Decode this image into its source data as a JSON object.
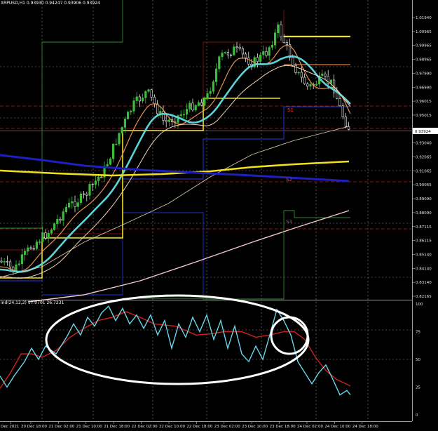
{
  "window": {
    "main_title": "XRPUSD,H1  0.93930 0.94247 0.93906 0.93924",
    "indicator_title": "ind(24,12,2) 17.0701 26.7231",
    "current_price": "0.93924"
  },
  "chart_data": {
    "type": "candlestick",
    "price_axis": {
      "labels": [
        "1.01940",
        "1.00965",
        "0.99965",
        "0.98965",
        "0.97990",
        "0.96990",
        "0.96015",
        "0.95015",
        "0.94015",
        "0.93040",
        "0.92065",
        "0.91065",
        "0.90065",
        "0.89090",
        "0.88090",
        "0.87115",
        "0.86115",
        "0.85140",
        "0.84140",
        "0.83140",
        "0.82165"
      ],
      "ylim": [
        0.8204,
        1.0206
      ]
    },
    "oscillator_axis": {
      "labels": [
        "100",
        "75",
        "50",
        "25",
        "0"
      ],
      "ylim": [
        0,
        100
      ]
    },
    "time_axis": {
      "labels": [
        "Dec 2021",
        "20 Dec 18:00",
        "21 Dec 02:00",
        "21 Dec 10:00",
        "21 Dec 18:00",
        "22 Dec 02:00",
        "22 Dec 10:00",
        "22 Dec 18:00",
        "23 Dec 02:00",
        "23 Dec 10:00",
        "23 Dec 18:00",
        "24 Dec 02:00",
        "24 Dec 10:00",
        "24 Dec 18:00"
      ]
    },
    "pivot_labels": [
      "S1",
      "S2",
      "S3"
    ],
    "colors": {
      "bull_candle": "#3dbd3d",
      "bear_candle": "#e8e8e8",
      "ema_fast": "#e39252",
      "ema_mid": "#5bd3d8",
      "ma_slow": "#f5d3b3",
      "ma_long": "#f2c8c8",
      "ma_yellow": "#f2e020",
      "ma_blue": "#1f1fbf",
      "osc_main": "#6ad4e8",
      "osc_signal": "#d02020",
      "annotation": "#ffffff"
    }
  }
}
